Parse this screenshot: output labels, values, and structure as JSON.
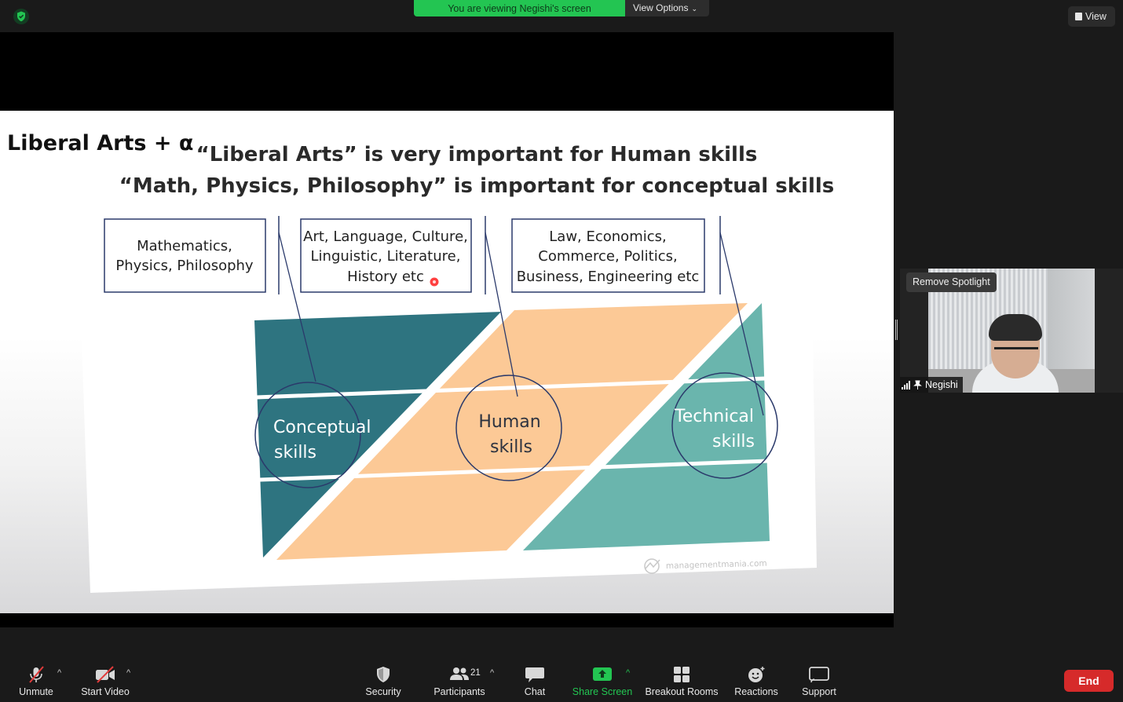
{
  "topbar": {
    "banner": "You are viewing Negishi's screen",
    "view_options": "View Options",
    "view_button": "View"
  },
  "slide": {
    "corner_title": "Liberal Arts + α",
    "headline_1": "“Liberal Arts” is very important for Human skills",
    "headline_2": "“Math, Physics, Philosophy” is important for conceptual skills",
    "boxes": [
      [
        "Mathematics,",
        "Physics, Philosophy"
      ],
      [
        "Art, Language, Culture,",
        "Linguistic, Literature,",
        "History etc"
      ],
      [
        "Law, Economics,",
        "Commerce, Politics,",
        "Business,  Engineering etc"
      ]
    ],
    "circles": [
      [
        "Conceptual",
        "skills"
      ],
      [
        "Human",
        "skills"
      ],
      [
        "Technical",
        "skills"
      ]
    ],
    "watermark": "managementmania.com",
    "colors": {
      "conceptual": "#2e7480",
      "human": "#fcc996",
      "technical": "#6ab5ad",
      "line": "#2b3a6b"
    }
  },
  "video": {
    "spotlight_tip": "Remove Spotlight",
    "participant_name": "Negishi"
  },
  "toolbar": {
    "unmute": "Unmute",
    "start_video": "Start Video",
    "security": "Security",
    "participants": "Participants",
    "participant_count": "21",
    "chat": "Chat",
    "share_screen": "Share Screen",
    "breakout_rooms": "Breakout Rooms",
    "reactions": "Reactions",
    "support": "Support",
    "end": "End"
  }
}
